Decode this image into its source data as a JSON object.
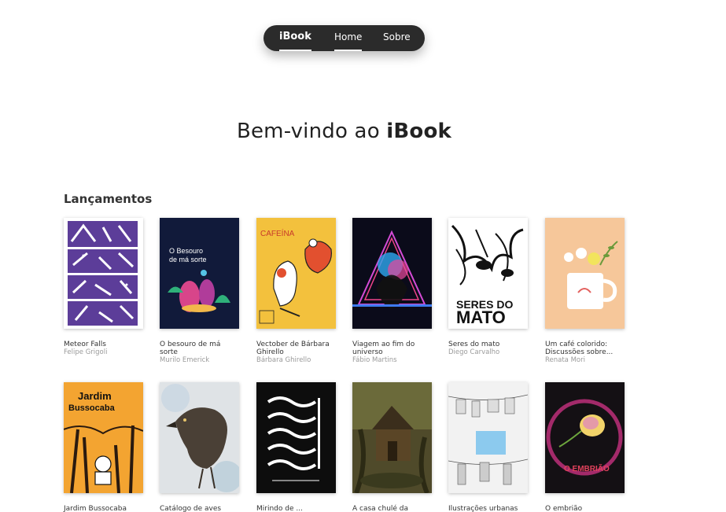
{
  "nav": {
    "brand": "iBook",
    "links": [
      "Home",
      "Sobre"
    ]
  },
  "hero": {
    "prefix": "Bem-vindo ao ",
    "brand": "iBook"
  },
  "section": {
    "title": "Lançamentos"
  },
  "books": [
    {
      "title": "Meteor Falls",
      "author": "Felipe Grigoli",
      "cover_text": "MET EOR FAL LS"
    },
    {
      "title": "O besouro de má sorte",
      "author": "Murilo Emerick",
      "cover_text": "O Besouro de má sorte"
    },
    {
      "title": "Vectober de Bárbara Ghirello",
      "author": "Bárbara Ghirello",
      "cover_text": "CAFEÍNA"
    },
    {
      "title": "Viagem ao fim do universo",
      "author": "Fábio Martins",
      "cover_text": ""
    },
    {
      "title": "Seres do mato",
      "author": "Diego Carvalho",
      "cover_text": "SERES DO MATO"
    },
    {
      "title": "Um café colorido: Discussões sobre...",
      "author": "Renata Mori",
      "cover_text": ""
    },
    {
      "title": "Jardim Bussocaba",
      "author": "",
      "cover_text": "Jardim Bussocaba"
    },
    {
      "title": "Catálogo de aves",
      "author": "",
      "cover_text": ""
    },
    {
      "title": "Mirindo de ...",
      "author": "",
      "cover_text": ""
    },
    {
      "title": "A casa chulé da",
      "author": "",
      "cover_text": ""
    },
    {
      "title": "Ilustrações urbanas",
      "author": "",
      "cover_text": ""
    },
    {
      "title": "O embrião",
      "author": "",
      "cover_text": "O EMBRIÃO"
    }
  ],
  "colors": {
    "nav_bg": "#2b2b2b",
    "meteor": "#5c3d99",
    "besouro": "#111a3a",
    "cafeina": "#f3c13d",
    "viagem": "#0b0b1a",
    "seres": "#ffffff",
    "cafe": "#f6c79a",
    "jardim": "#f3a431",
    "aves": "#dfe3e6",
    "mirindo": "#0d0d0d",
    "casa": "#4f4a2a",
    "ilustracoes": "#f2f2f2",
    "embriao": "#141014"
  }
}
